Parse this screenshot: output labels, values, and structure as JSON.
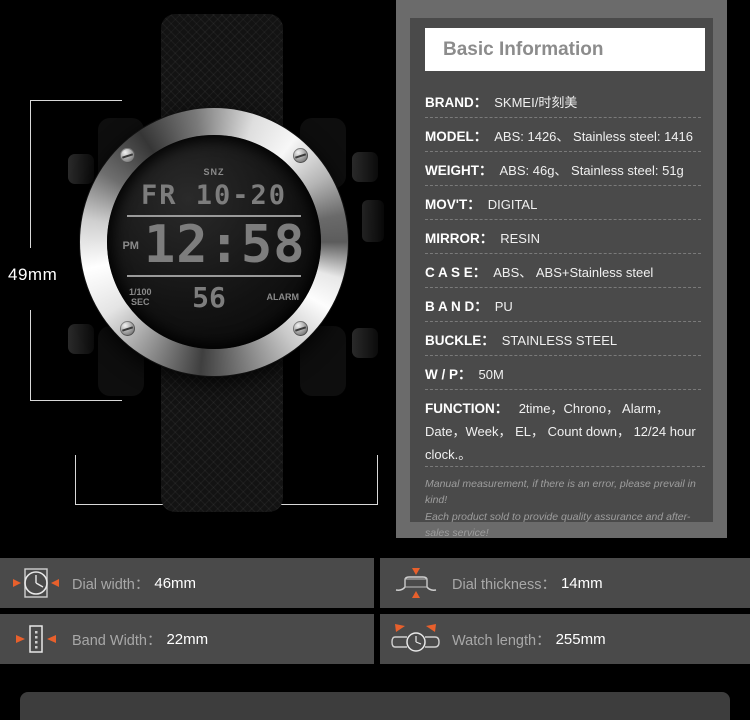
{
  "product": {
    "dimensions": {
      "height_label": "49mm",
      "width_label": "46mm"
    },
    "watch_display": {
      "snooze": "SNZ",
      "date": "FR 10-20",
      "meridiem": "PM",
      "time": "12:58",
      "stopwatch_label_line1": "1/100",
      "stopwatch_label_line2": "SEC",
      "seconds": "56",
      "alarm_label": "ALARM"
    }
  },
  "spec_panel": {
    "title": "Basic Information",
    "rows": [
      {
        "label": "BRAND：",
        "value": "SKMEI/时刻美"
      },
      {
        "label": "MODEL：",
        "value": "ABS: 1426、 Stainless steel: 1416"
      },
      {
        "label": "WEIGHT：",
        "value": "ABS: 46g、 Stainless steel: 51g"
      },
      {
        "label": "MOV'T：",
        "value": "DIGITAL"
      },
      {
        "label": "MIRROR：",
        "value": "RESIN"
      },
      {
        "label": "C A S E：",
        "value": "ABS、 ABS+Stainless steel"
      },
      {
        "label": "B A N D：",
        "value": "PU"
      },
      {
        "label": "BUCKLE：",
        "value": "STAINLESS STEEL"
      },
      {
        "label": "W / P：",
        "value": "50M"
      }
    ],
    "function_row": {
      "label": "FUNCTION：",
      "value": "2time，Chrono， Alarm， Date，Week， EL， Count down， 12/24 hour clock.。"
    },
    "disclaimer_line1": "Manual measurement, if there is an error, please prevail in kind!",
    "disclaimer_line2": "Each product sold to provide quality assurance and after-sales service!"
  },
  "measurements": [
    {
      "icon": "dial-width-icon",
      "label": "Dial width：",
      "value": "46mm"
    },
    {
      "icon": "dial-thickness-icon",
      "label": "Dial thickness：",
      "value": "14mm"
    },
    {
      "icon": "band-width-icon",
      "label": "Band Width：",
      "value": "22mm"
    },
    {
      "icon": "watch-length-icon",
      "label": "Watch length：",
      "value": "255mm"
    }
  ],
  "colors": {
    "background": "#000000",
    "panel_outer": "#6b6b6b",
    "panel_inner": "#4a4a4a",
    "header_background": "#ffffff",
    "header_text": "#8c8c8c",
    "accent_orange": "#e8602c"
  }
}
